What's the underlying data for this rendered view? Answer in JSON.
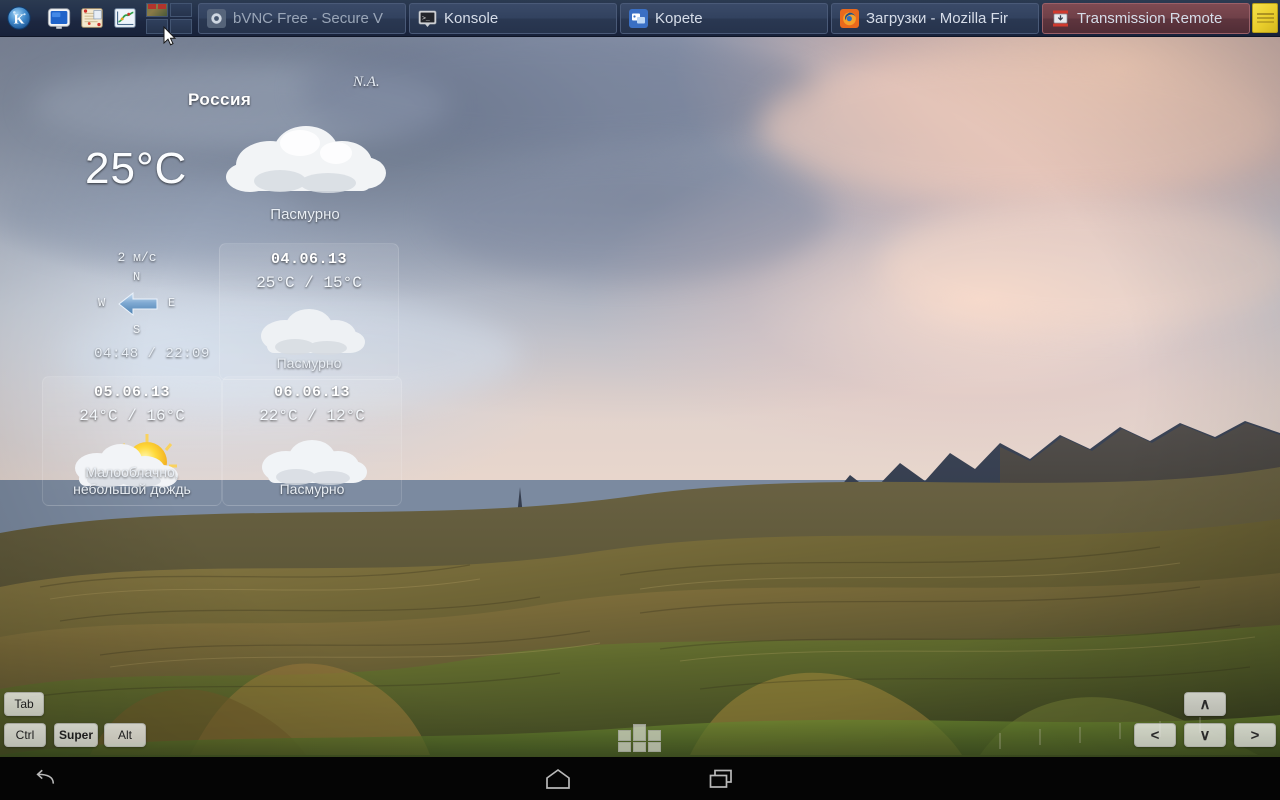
{
  "taskbar": {
    "launchers": [
      {
        "name": "kde-menu-icon",
        "label": "K"
      },
      {
        "name": "display-icon",
        "label": ""
      },
      {
        "name": "notes-icon",
        "label": ""
      },
      {
        "name": "chart-icon",
        "label": ""
      }
    ],
    "pager": {
      "name": "desktop-pager",
      "desktops": 4,
      "active": 1
    },
    "tasks": [
      {
        "title": "bVNC Free - Secure V",
        "icon": "bvnc-icon",
        "state": "inactive"
      },
      {
        "title": "Konsole",
        "icon": "konsole-icon",
        "state": "inactive"
      },
      {
        "title": "Kopete",
        "icon": "kopete-icon",
        "state": "inactive"
      },
      {
        "title": "Загрузки - Mozilla Fir",
        "icon": "firefox-icon",
        "state": "inactive"
      },
      {
        "title": "Transmission Remote",
        "icon": "transmission-icon",
        "state": "attention"
      }
    ],
    "tray": {
      "note_widget": "sticky-note-widget"
    },
    "colors": {
      "bar_top": "#2b3a51",
      "bar_bottom": "#18223a",
      "task_border": "#4a5a78",
      "attention": "#7e4a52"
    }
  },
  "weather": {
    "country": "Россия",
    "location": "N.A.",
    "current_temp": "25°C",
    "current_condition": "Пасмурно",
    "wind": {
      "speed": "2 м/с",
      "direction": "W",
      "compass": {
        "n": "N",
        "s": "S",
        "w": "W",
        "e": "E"
      }
    },
    "sun": {
      "sunrise": "04:48",
      "separator": "/",
      "sunset": "22:09",
      "display": "04:48 / 22:09"
    },
    "forecast": [
      {
        "date": "04.06.13",
        "temps": "25°C / 15°C",
        "high": "25°C",
        "low": "15°C",
        "condition": "Пасмурно",
        "icon": "cloudy-icon"
      },
      {
        "date": "05.06.13",
        "temps": "24°C / 16°C",
        "high": "24°C",
        "low": "16°C",
        "condition": "Малооблачно,\nнебольшой дождь",
        "icon": "partly-sunny-rain-icon"
      },
      {
        "date": "06.06.13",
        "temps": "22°C / 12°C",
        "high": "22°C",
        "low": "12°C",
        "condition": "Пасмурно",
        "icon": "cloudy-icon"
      }
    ]
  },
  "overlay_keys": {
    "modifiers": [
      {
        "label": "Tab",
        "pressed": false
      },
      {
        "label": "Ctrl",
        "pressed": false
      },
      {
        "label": "Super",
        "pressed": true
      },
      {
        "label": "Alt",
        "pressed": false
      }
    ],
    "arrows": {
      "up": "∧",
      "down": "∨",
      "left": "<",
      "right": ">"
    },
    "keyboard_toggle": "mini-keyboard-toggle"
  },
  "navbar": {
    "back": "back-icon",
    "home": "home-icon",
    "recents": "recents-icon"
  }
}
